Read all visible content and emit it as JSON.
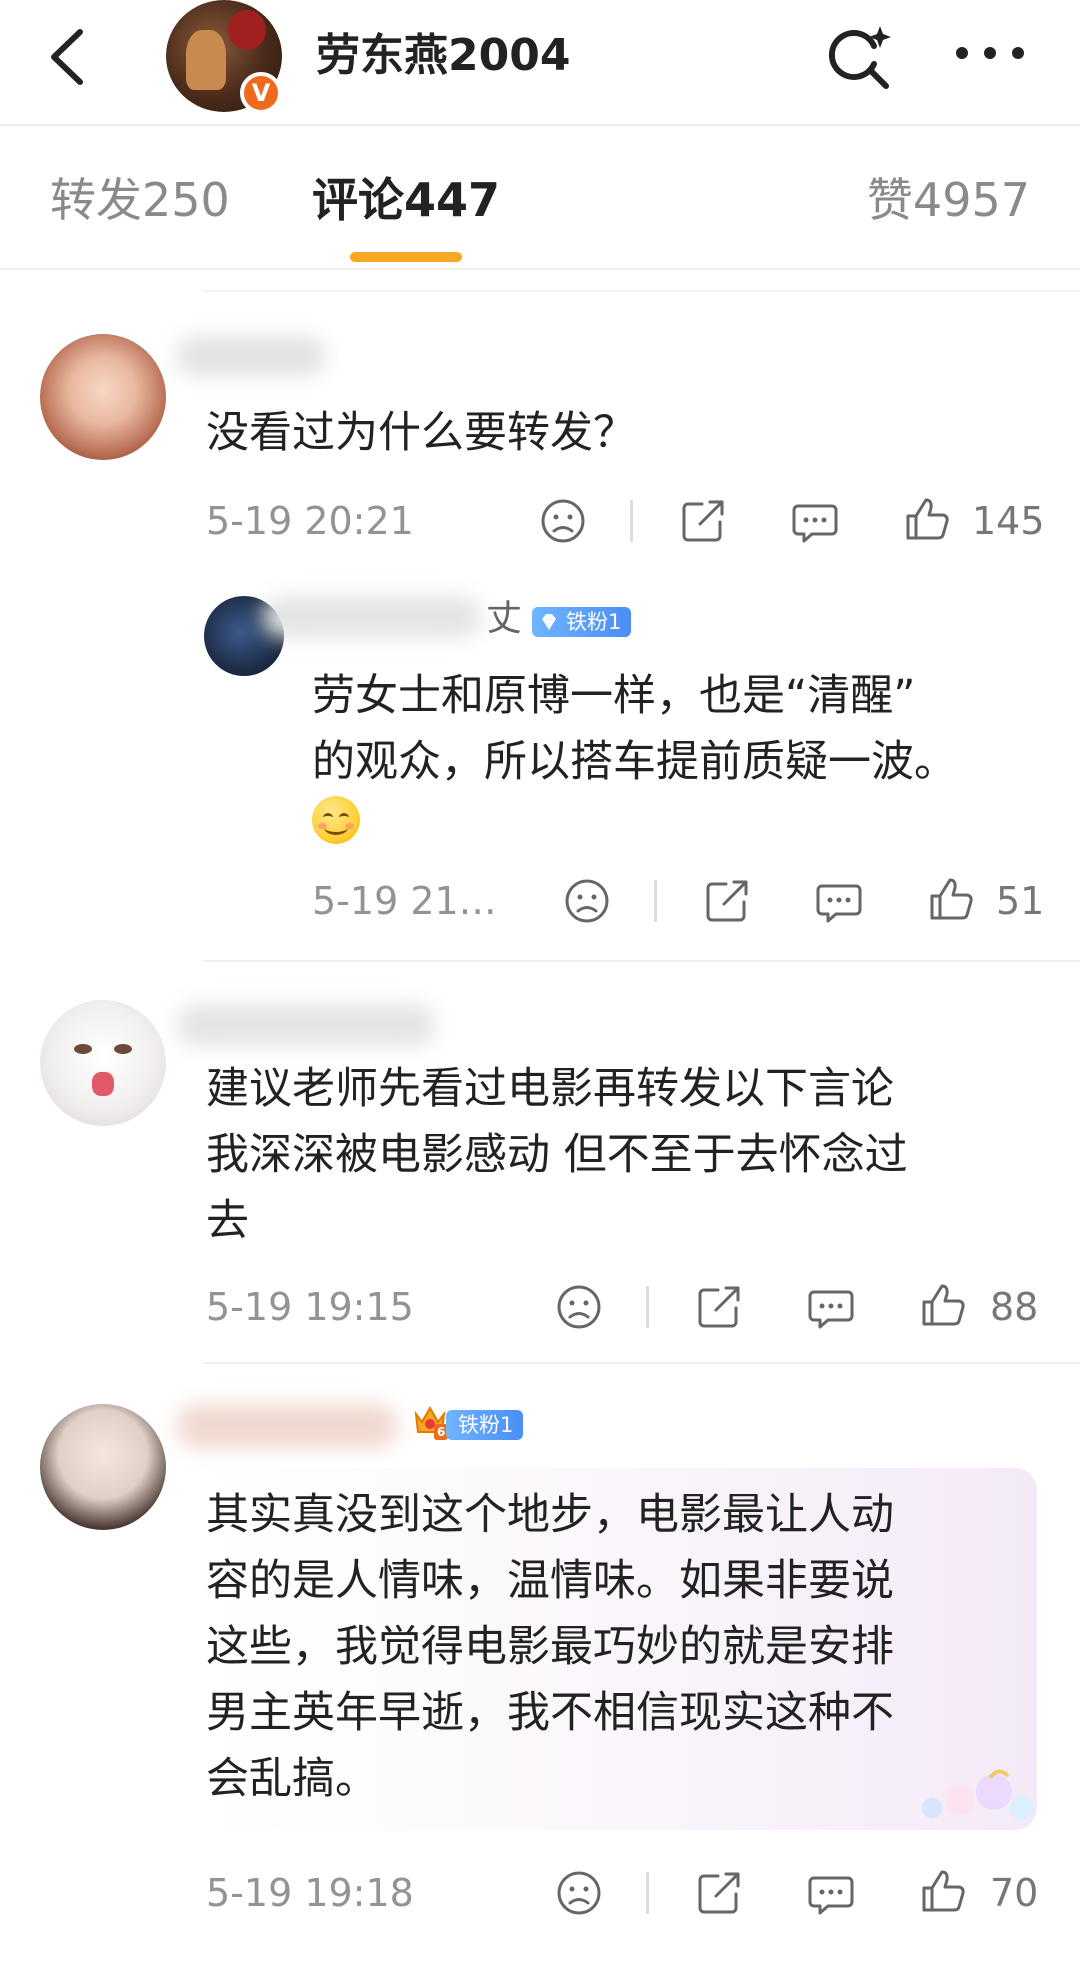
{
  "header": {
    "author_name": "劳东燕2004",
    "verified_badge": "V",
    "icons": {
      "back": "back-arrow-icon",
      "search": "search-sparkle-icon",
      "more": "more-dots-icon"
    }
  },
  "tabs": {
    "repost": {
      "label": "转发",
      "count": "250"
    },
    "comments": {
      "label": "评论",
      "count": "447"
    },
    "likes": {
      "label": "赞",
      "count": "4957"
    }
  },
  "comments": [
    {
      "text": "没看过为什么要转发？",
      "time": "5-19 20:21",
      "likes": "145",
      "replies": [
        {
          "name_suffix": "丈",
          "badge": "铁粉1",
          "text_line1": "劳女士和原博一样，也是“清醒”",
          "text_line2": "的观众，所以搭车提前质疑一波。",
          "emoji": "smile-emoji",
          "time": "5-19 21…",
          "likes": "51"
        }
      ]
    },
    {
      "text_line1": "建议老师先看过电影再转发以下言论",
      "text_line2": "我深深被电影感动 但不至于去怀念过",
      "text_line3": "去",
      "time": "5-19 19:15",
      "likes": "88"
    },
    {
      "badge": "铁粉1",
      "crown_level": "6",
      "text_line1": "其实真没到这个地步，电影最让人动",
      "text_line2": "容的是人情味，温情味。如果非要说",
      "text_line3": "这些，我觉得电影最巧妙的就是安排",
      "text_line4": "男主英年早逝，我不相信现实这种不",
      "text_line5": "会乱搞。",
      "time": "5-19 19:18",
      "likes": "70"
    }
  ],
  "colors": {
    "accent_orange": "#f7a824",
    "verified_orange": "#f06a1e",
    "badge_blue": "#4b8df5",
    "text_primary": "#222222",
    "text_secondary": "#939393"
  }
}
